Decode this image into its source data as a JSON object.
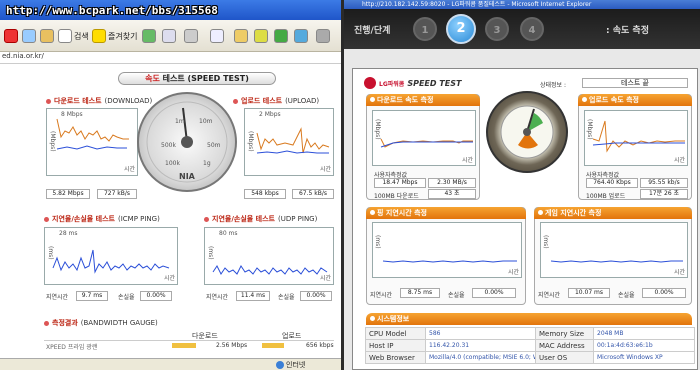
{
  "left": {
    "watermark": "http://www.bcpark.net/bbs/315568",
    "toolbar": {
      "search_label": "검색",
      "favorites_label": "즐겨찾기"
    },
    "address": "ed.nia.or.kr/",
    "speed_title_ko": "속도",
    "speed_title_rest": " 테스트 (SPEED TEST)",
    "download": {
      "title_ko": "다운로드 테스트",
      "title_en": "(DOWNLOAD)",
      "graph_max": "8 Mbps",
      "ylabel": "(Mbps)",
      "xlabel": "시간",
      "val1": "5.82 Mbps",
      "val2": "727 kB/s"
    },
    "upload": {
      "title_ko": "업로드 테스트",
      "title_en": "(UPLOAD)",
      "graph_max": "2 Mbps",
      "ylabel": "(Mbps)",
      "xlabel": "시간",
      "val1": "548 kbps",
      "val2": "67.5 kB/s"
    },
    "gauge": {
      "ticks": [
        "1m",
        "10m",
        "500k",
        "50m",
        "100k",
        "1g"
      ],
      "brand": "NIA"
    },
    "icmp": {
      "title_ko": "지연율/손실율 테스트",
      "title_en": "(ICMP PING)",
      "graph_max": "28 ms",
      "ylabel": "(ms)",
      "xlabel": "시간",
      "delay_label": "지연시간",
      "delay_val": "9.7 ms",
      "loss_label": "손실율",
      "loss_val": "0.00%"
    },
    "udp": {
      "title_ko": "지연율/손실율 테스트",
      "title_en": "(UDP PING)",
      "graph_max": "80 ms",
      "ylabel": "(ms)",
      "xlabel": "시간",
      "delay_label": "지연시간",
      "delay_val": "11.4 ms",
      "loss_label": "손실율",
      "loss_val": "0.00%"
    },
    "bandwidth": {
      "title_ko": "측정결과",
      "title_en": "(BANDWIDTH GAUGE)",
      "col_down": "다운로드",
      "col_up": "업로드",
      "row_label": "XPEED 프라임 광랜",
      "row_down": "2.56 Mbps",
      "row_up": "656 kbps"
    },
    "status": "인터넷"
  },
  "right": {
    "title": "http://210.182.142.59:8020 - LG파워콤 품질테스트 - Microsoft Internet Explorer",
    "step_label": "진행/단계",
    "steps": [
      "1",
      "2",
      "3",
      "4"
    ],
    "active_step": 2,
    "step_title": ": 속도 측정",
    "logo": "LG파워콤",
    "speed_test": "SPEED TEST",
    "state_label": "상태정보 :",
    "state_value": "테스트 끝",
    "download": {
      "title": "다운로드 속도 측정",
      "ylabel": "(Mbps)",
      "xlabel": "시간",
      "avg_label": "사용자측정값",
      "avg_mbps": "18.47 Mbps",
      "avg_mbs": "2.30 MB/s",
      "base_label": "100MB 다운로드",
      "base_time": "43 초"
    },
    "upload": {
      "title": "업로드 속도 측정",
      "ylabel": "(Mbps)",
      "xlabel": "시간",
      "avg_label": "사용자측정값",
      "avg_kbps": "764.40 Kbps",
      "avg_kbs": "95.55 kb/s",
      "base_label": "100MB 업로드",
      "base_time": "17분 26 초"
    },
    "ping": {
      "title": "핑 지연시간 측정",
      "ylabel": "(ms)",
      "xlabel": "시간",
      "delay_label": "지연시간",
      "delay_val": "8.75 ms",
      "loss_label": "손실율",
      "loss_val": "0.00%"
    },
    "game": {
      "title": "게임 지연시간 측정",
      "ylabel": "(ms)",
      "xlabel": "시간",
      "delay_label": "지연시간",
      "delay_val": "10.07 ms",
      "loss_label": "손실율",
      "loss_val": "0.00%"
    },
    "system": {
      "title": "시스템정보",
      "rows": [
        {
          "k1": "CPU Model",
          "v1": "586",
          "k2": "Memory Size",
          "v2": "2048 MB"
        },
        {
          "k1": "Host IP",
          "v1": "116.42.20.31",
          "k2": "MAC Address",
          "v2": "00:1a:4d:63:e6:1b"
        },
        {
          "k1": "Web Browser",
          "v1": "Mozilla/4.0 (compatible; MSIE 6.0; Wind",
          "k2": "User OS",
          "v2": "Microsoft Windows XP"
        }
      ]
    }
  },
  "colors": {
    "accent_orange": "#e2740c",
    "graph_blue": "#2b4fd8",
    "graph_orange": "#d97a1f",
    "lg_red": "#c8102e"
  }
}
